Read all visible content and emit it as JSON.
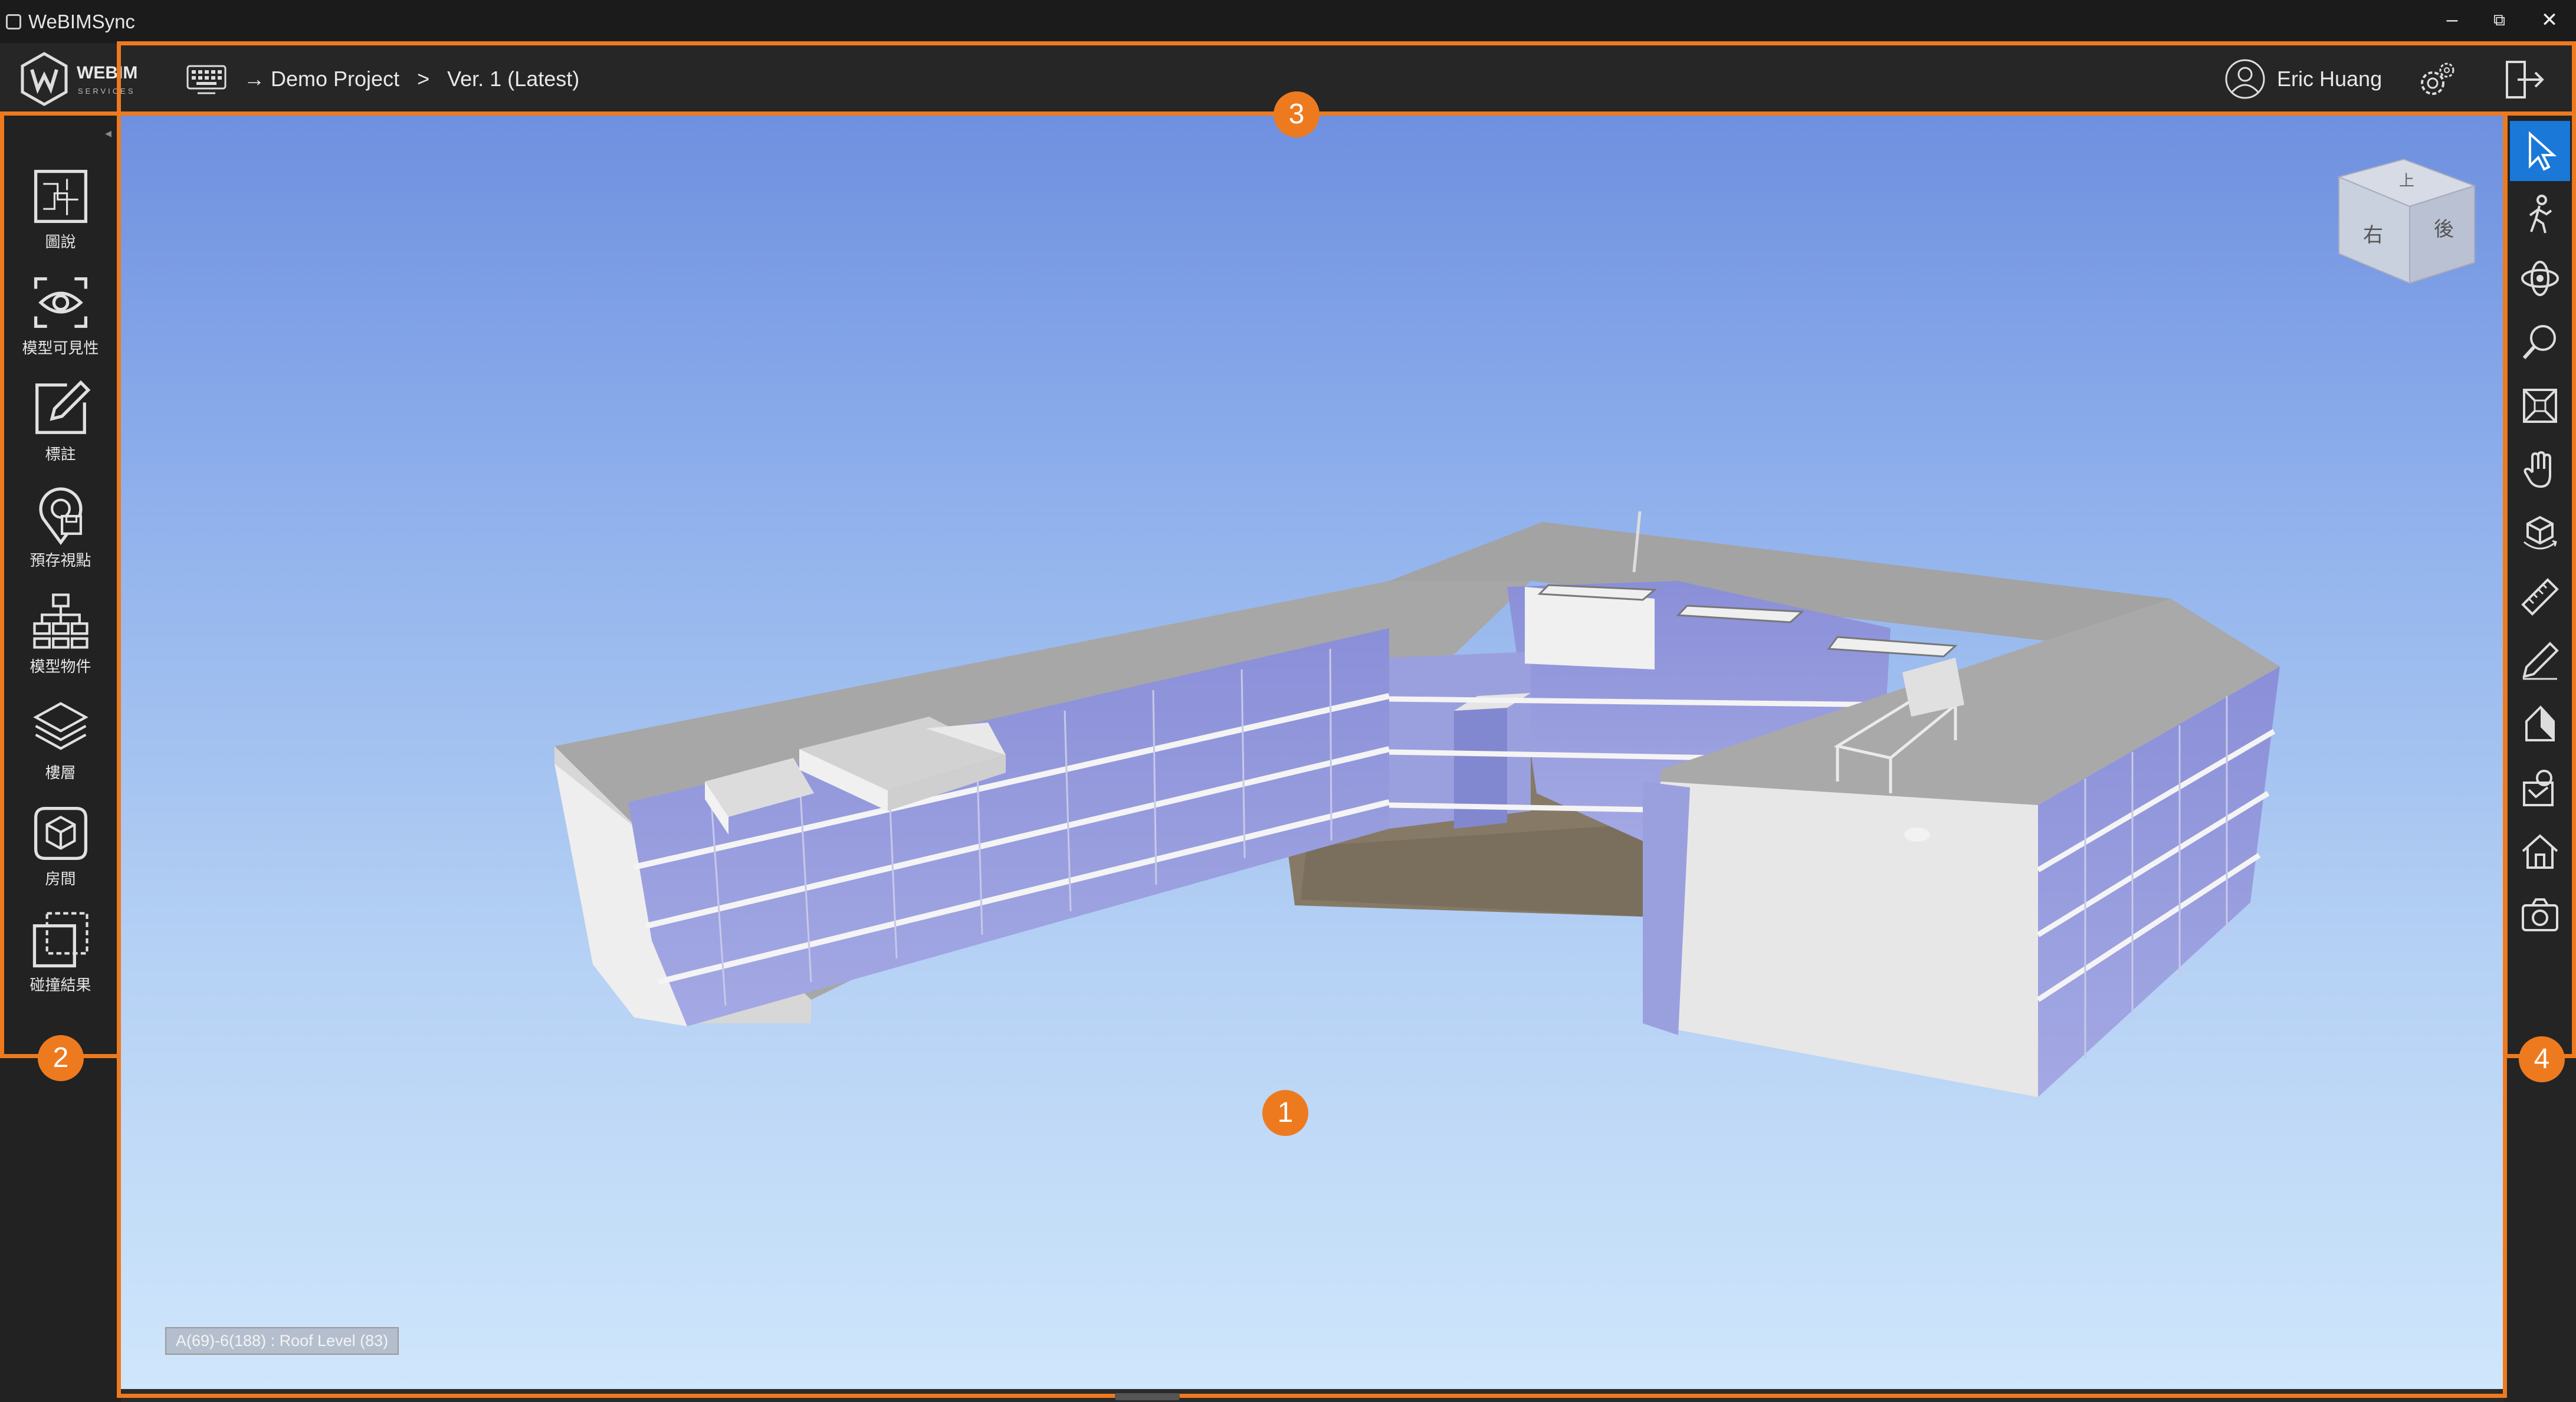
{
  "window": {
    "title": "WeBIMSync",
    "minimize": "–",
    "restore": "⧉",
    "close": "✕"
  },
  "header": {
    "logo_text": "WEBIM",
    "logo_sub": "SERVICES",
    "breadcrumb": {
      "project": "→ Demo Project",
      "separator": ">",
      "version": "Ver. 1 (Latest)"
    },
    "user_name": "Eric Huang",
    "icons": [
      "keyboard-icon",
      "user-icon",
      "settings-icon",
      "logout-icon"
    ]
  },
  "sidebar": {
    "items": [
      {
        "label": "圖說",
        "icon": "drawings-icon"
      },
      {
        "label": "模型可見性",
        "icon": "visibility-eye-icon"
      },
      {
        "label": "標註",
        "icon": "markup-pencil-icon"
      },
      {
        "label": "預存視點",
        "icon": "saved-viewpoint-icon"
      },
      {
        "label": "模型物件",
        "icon": "model-tree-icon"
      },
      {
        "label": "樓層",
        "icon": "levels-layers-icon"
      },
      {
        "label": "房間",
        "icon": "room-cube-icon"
      },
      {
        "label": "碰撞結果",
        "icon": "clash-results-icon"
      }
    ]
  },
  "viewport": {
    "status_text": "A(69)-6(188) : Roof Level (83)",
    "viewcube": {
      "right_face": "右",
      "back_face": "後",
      "top_face": "上"
    }
  },
  "toolbar": {
    "tools": [
      {
        "name": "select-tool",
        "icon": "cursor-icon",
        "active": true
      },
      {
        "name": "walk-tool",
        "icon": "walk-person-icon"
      },
      {
        "name": "orbit-tool",
        "icon": "orbit-icon"
      },
      {
        "name": "zoom-tool",
        "icon": "zoom-magnifier-icon"
      },
      {
        "name": "fit-tool",
        "icon": "fit-frame-icon"
      },
      {
        "name": "pan-tool",
        "icon": "hand-pan-icon"
      },
      {
        "name": "rotate-model-tool",
        "icon": "rotate-cube-icon"
      },
      {
        "name": "measure-tool",
        "icon": "ruler-icon"
      },
      {
        "name": "section-tool",
        "icon": "section-pencil-icon"
      },
      {
        "name": "clip-plane-tool",
        "icon": "cut-plane-icon"
      },
      {
        "name": "properties-tool",
        "icon": "properties-icon"
      },
      {
        "name": "home-view-tool",
        "icon": "home-icon"
      },
      {
        "name": "screenshot-tool",
        "icon": "camera-icon"
      }
    ]
  },
  "callouts": {
    "one": "1",
    "two": "2",
    "three": "3",
    "four": "4"
  },
  "colors": {
    "accent": "#ee7a1f",
    "active_tool": "#1a78d8",
    "chrome_dark": "#222222"
  }
}
